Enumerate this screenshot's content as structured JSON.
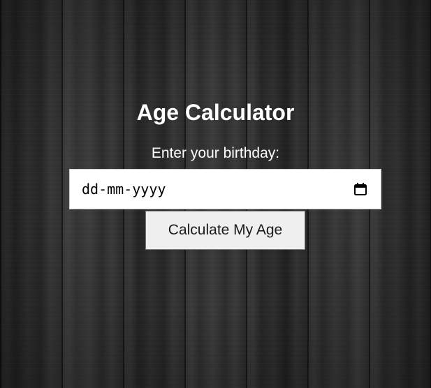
{
  "app": {
    "title": "Age Calculator",
    "prompt_label": "Enter your birthday:"
  },
  "birthday_input": {
    "placeholder": "dd-mm-yyyy",
    "value": "",
    "icon": "calendar-icon"
  },
  "actions": {
    "calculate_label": "Calculate My Age"
  },
  "colors": {
    "text": "#ffffff",
    "button_bg": "#efefef",
    "input_bg": "#ffffff"
  }
}
